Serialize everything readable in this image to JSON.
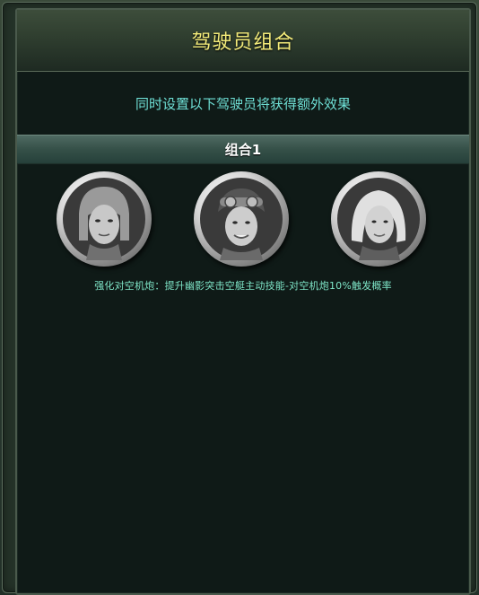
{
  "title": "驾驶员组合",
  "subtitle": "同时设置以下驾驶员将获得额外效果",
  "combo": {
    "name": "组合1",
    "pilots": [
      {
        "icon": "pilot-portrait-female-helmet-icon"
      },
      {
        "icon": "pilot-portrait-male-goggles-icon"
      },
      {
        "icon": "pilot-portrait-female-blonde-icon"
      }
    ],
    "effect": "强化对空机炮：提升幽影突击空艇主动技能-对空机炮10%触发概率"
  },
  "colors": {
    "title": "#f4ec7a",
    "subtitle": "#6fe0d6",
    "effect": "#7fe6c8",
    "panel_bg": "#0f1a17"
  }
}
